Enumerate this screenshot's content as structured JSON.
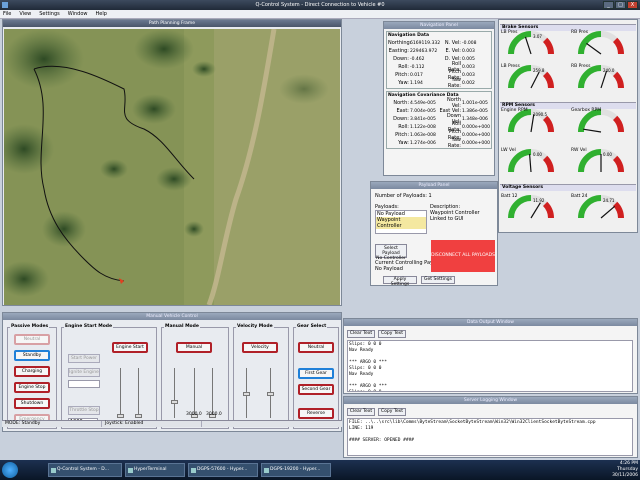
{
  "app": {
    "title": "Q-Control System - Direct Connection to Vehicle #0",
    "menu": [
      "File",
      "View",
      "Settings",
      "Window",
      "Help"
    ],
    "window_buttons": [
      "_",
      "□",
      "X"
    ]
  },
  "map": {
    "title": "Path Planning Frame"
  },
  "navigation": {
    "title": "Navigation Panel",
    "data_title": "Navigation Data",
    "rows": [
      {
        "l1": "Northing:",
        "v1": "6169119.332",
        "l2": "N. Vel:",
        "v2": "-0.008"
      },
      {
        "l1": "Easting:",
        "v1": "229463.972",
        "l2": "E. Vel:",
        "v2": "0.003"
      },
      {
        "l1": "Down:",
        "v1": "-0.462",
        "l2": "D. Vel:",
        "v2": "0.005"
      },
      {
        "l1": "Roll:",
        "v1": "-0.112",
        "l2": "Roll Rate:",
        "v2": "0.003"
      },
      {
        "l1": "Pitch:",
        "v1": "0.017",
        "l2": "Pitch Rate:",
        "v2": "0.003"
      },
      {
        "l1": "Yaw:",
        "v1": "1.194",
        "l2": "Yaw Rate:",
        "v2": "0.002"
      }
    ],
    "cov_title": "Navigation Covariance Data",
    "cov_rows": [
      {
        "l1": "North:",
        "v1": "4.549e-005",
        "l2": "North Vel:",
        "v2": "1.001e-005"
      },
      {
        "l1": "East:",
        "v1": "7.004e-005",
        "l2": "East Vel:",
        "v2": "1.386e-005"
      },
      {
        "l1": "Down:",
        "v1": "3.841e-005",
        "l2": "Down Vel:",
        "v2": "1.348e-006"
      },
      {
        "l1": "Roll:",
        "v1": "1.122e-008",
        "l2": "Roll Rate:",
        "v2": "0.000e+000"
      },
      {
        "l1": "Pitch:",
        "v1": "1.063e-008",
        "l2": "Pitch Rate:",
        "v2": "0.000e+000"
      },
      {
        "l1": "Yaw:",
        "v1": "1.274e-006",
        "l2": "Yaw Rate:",
        "v2": "0.000e+000"
      }
    ]
  },
  "sensors": {
    "brake_title": "Brake Sensors",
    "rpm_title": "RPM Sensors",
    "voltage_title": "Voltage Sensors",
    "gauges": [
      {
        "label": "LB Pres",
        "value": "3.07"
      },
      {
        "label": "RB Pres",
        "value": ""
      },
      {
        "label": "LB Press",
        "value": "259.8"
      },
      {
        "label": "RB Press",
        "value": "240.0"
      },
      {
        "label": "Engine RPM",
        "value": "1090.5"
      },
      {
        "label": "Gearbox RPM",
        "value": ""
      },
      {
        "label": "LW Vel",
        "value": "0.00"
      },
      {
        "label": "RW Vel",
        "value": "0.00"
      },
      {
        "label": "Batt 12",
        "value": "11.92"
      },
      {
        "label": "Batt 24",
        "value": "24.71"
      }
    ]
  },
  "payload": {
    "title": "Payload Panel",
    "num_label": "Number of Payloads:",
    "num_value": "1",
    "payloads_label": "Payloads:",
    "items": [
      "No Payload",
      "Waypoint Controller"
    ],
    "desc_label": "Description:",
    "desc_value": "Waypoint Controller Linked to GUI",
    "select_btn": "Select Payload",
    "no_ctrl_btn": "No Controller",
    "current_label": "Current Controlling Payload:",
    "current_value": "No Payload",
    "disconnect_btn": "DISCONNECT ALL PAYLOADS",
    "apply_btn": "Apply Settings",
    "get_btn": "Get Settings"
  },
  "vehicle": {
    "title": "Manual Vehicle Control",
    "passive": {
      "title": "Passive Modes",
      "buttons": [
        "Neutral",
        "Standby",
        "Charging",
        "Engine Stop",
        "Shutdown",
        "Emergency"
      ]
    },
    "engine": {
      "title": "Engine Start Mode",
      "buttons": [
        "Start Power",
        "Ignite Engine",
        "Engine Start",
        "Throttle Stop"
      ],
      "value": "1000",
      "sliders": [
        "Throttle",
        "Choke"
      ]
    },
    "manual": {
      "title": "Manual Mode",
      "button": "Manual",
      "sliders": [
        "Throttle",
        "LB",
        "RB"
      ],
      "vals": [
        "3000.0",
        "3000.0"
      ]
    },
    "velocity": {
      "title": "Velocity Mode",
      "button": "Velocity",
      "sliders": [
        "Velocity",
        "Turn Rate"
      ]
    },
    "gear": {
      "title": "Gear Select",
      "buttons": [
        "Neutral",
        "First Gear",
        "Second Gear",
        "Reverse"
      ]
    },
    "status": [
      "MODE: Standby",
      "Joystick: Enabled"
    ]
  },
  "console1": {
    "title": "Data Output Window",
    "clear": "Clear Text",
    "copy": "Copy Text",
    "text": "Slips: 0 0 0\nNav Ready\n\n*** ARGO 0 ***\nSlips: 0 0 0\nNav Ready\n\n*** ARGO 0 ***\nSlips: 0 0 0\nNav Ready"
  },
  "console2": {
    "title": "Server Logging Window",
    "clear": "Clear Text",
    "copy": "Copy Text",
    "text": "FILE: ..\\..\\src\\lib\\Comms\\ByteStream\\SocketByteStream\\Win32\\Win32ClientSocketByteStream.cpp\nLINE: 119\n\n#### SERVER: OPENED ####"
  },
  "taskbar": {
    "items": [
      "Q-Control System - D...",
      "HyperTerminal",
      "DGPS-57600 - Hyper...",
      "DGPS-19200 - Hyper..."
    ],
    "time": "4:26 PM",
    "day": "Thursday",
    "date": "30/11/2006"
  }
}
